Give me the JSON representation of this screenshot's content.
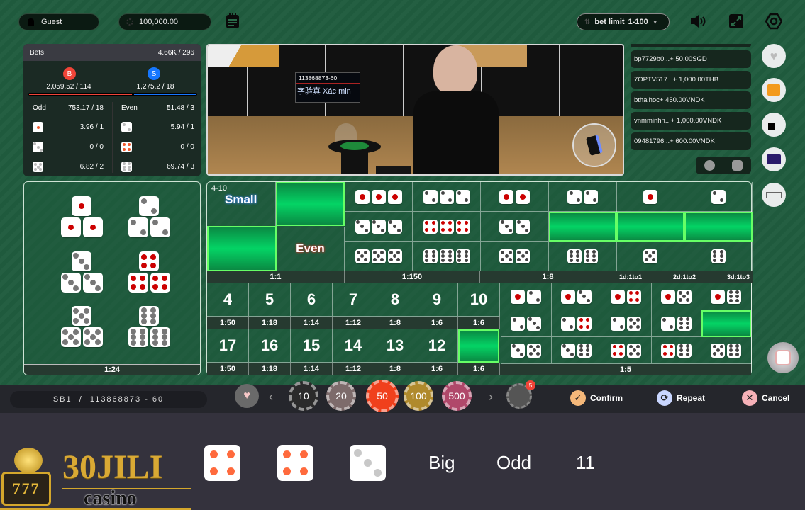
{
  "header": {
    "user_name": "Guest",
    "balance": "100,000.00",
    "bet_limit_label": "bet limit",
    "bet_limit_value": "1-100",
    "icons": [
      "user-icon",
      "coin-icon",
      "history-icon",
      "sound-icon",
      "fullscreen-icon",
      "settings-icon"
    ]
  },
  "bets_panel": {
    "title": "Bets",
    "total": "4.66K / 296",
    "big": {
      "badge": "B",
      "value": "2,059.52 / 114",
      "color": "#f04438"
    },
    "small": {
      "badge": "S",
      "value": "1,275.2 / 18",
      "color": "#1677ff"
    },
    "odd": {
      "label": "Odd",
      "value": "753.17 / 18"
    },
    "even": {
      "label": "Even",
      "value": "51.48 / 3"
    },
    "odd_rows": [
      {
        "die": 1,
        "value": "3.96 / 1"
      },
      {
        "die": 3,
        "value": "0 / 0"
      },
      {
        "die": 5,
        "value": "6.82 / 2"
      }
    ],
    "even_rows": [
      {
        "die": 2,
        "value": "5.94 / 1"
      },
      {
        "die": 4,
        "value": "0 / 0"
      },
      {
        "die": 6,
        "value": "69.74 / 3"
      }
    ]
  },
  "video": {
    "round_id": "113868873-60",
    "screen_text": "字验真 Xác min"
  },
  "feed": [
    {
      "text": "bp7729b0...+ 50.00SGD"
    },
    {
      "text": "7OPTV517...+ 1,000.00THB"
    },
    {
      "text": "bthaihoc+ 450.00VNDK"
    },
    {
      "text": "vnmminhn...+ 1,000.00VNDK"
    },
    {
      "text": "09481796...+ 600.00VNDK"
    }
  ],
  "side_buttons": [
    "favorite-icon",
    "gift-icon",
    "switch-table-icon",
    "video-quality-icon",
    "keyboard-icon"
  ],
  "board": {
    "any_triple_odds": "1:24",
    "small": {
      "range": "4-10",
      "label": "Small"
    },
    "even_label": "Even",
    "odds_1_1": "1:1",
    "odds_triple": "1:150",
    "odds_double": "1:8",
    "single_odds": [
      "1d:1to1",
      "2d:1to2",
      "3d:1to3"
    ],
    "totals_top": [
      {
        "n": "4",
        "odds": "1:50"
      },
      {
        "n": "5",
        "odds": "1:18"
      },
      {
        "n": "6",
        "odds": "1:14"
      },
      {
        "n": "7",
        "odds": "1:12"
      },
      {
        "n": "8",
        "odds": "1:8"
      },
      {
        "n": "9",
        "odds": "1:6"
      },
      {
        "n": "10",
        "odds": "1:6"
      }
    ],
    "totals_bottom": [
      {
        "n": "17",
        "odds": "1:50"
      },
      {
        "n": "16",
        "odds": "1:18"
      },
      {
        "n": "15",
        "odds": "1:14"
      },
      {
        "n": "14",
        "odds": "1:12"
      },
      {
        "n": "13",
        "odds": "1:8"
      },
      {
        "n": "12",
        "odds": "1:6"
      },
      {
        "n": "",
        "odds": "1:6"
      }
    ],
    "combo_odds": "1:5"
  },
  "bottom_bar": {
    "table_info": "SB1  /  113868873 - 60",
    "chips": [
      "10",
      "20",
      "50",
      "100",
      "500"
    ],
    "chip_badge": "5",
    "confirm": "Confirm",
    "repeat": "Repeat",
    "cancel": "Cancel"
  },
  "result": {
    "dice": [
      4,
      4,
      3
    ],
    "big_small": "Big",
    "odd_even": "Odd",
    "total": "11"
  },
  "brand": {
    "name": "30JILI",
    "sub": "casino",
    "slot": "777"
  }
}
